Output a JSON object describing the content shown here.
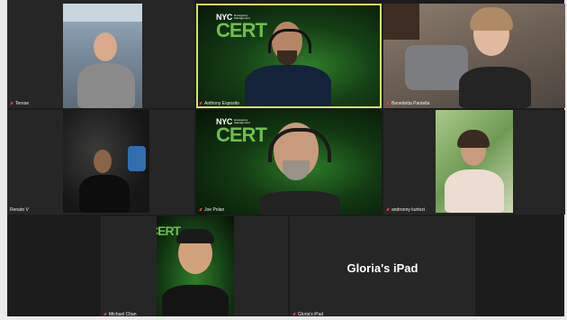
{
  "participants": [
    {
      "name": "Terese",
      "muted": true
    },
    {
      "name": "Anthony Esposito",
      "muted": true,
      "active_speaker": true
    },
    {
      "name": "Benedetta Pantella",
      "muted": true
    },
    {
      "name": "Renato V",
      "muted": true
    },
    {
      "name": "Joe Polan",
      "muted": true
    },
    {
      "name": "andronny kurtezi",
      "muted": true
    },
    {
      "name": "Michael Chan",
      "muted": true
    },
    {
      "name": "Gloria's iPad",
      "muted": true,
      "video_off": true,
      "display_text": "Gloria's iPad"
    }
  ],
  "background_logo": {
    "brand": "NYC",
    "sub": "Emergency Management",
    "main": "CERT"
  },
  "colors": {
    "active_border": "#d4e067",
    "cert_green": "#6cc04a",
    "muted_red": "#e03c3c"
  }
}
